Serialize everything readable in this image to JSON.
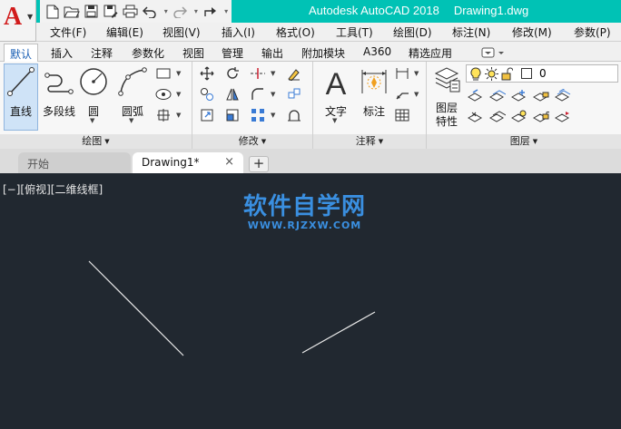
{
  "app": {
    "title": "Autodesk AutoCAD 2018",
    "document": "Drawing1.dwg",
    "logo": "A",
    "accent": "#00c2b5"
  },
  "quick_access": [
    "new-icon",
    "open-icon",
    "save-icon",
    "saveas-icon",
    "print-icon",
    "undo-icon",
    "redo-icon",
    "share-icon"
  ],
  "menu": [
    "文件(F)",
    "编辑(E)",
    "视图(V)",
    "插入(I)",
    "格式(O)",
    "工具(T)",
    "绘图(D)",
    "标注(N)",
    "修改(M)",
    "参数(P)"
  ],
  "ribbon_tabs": [
    "默认",
    "插入",
    "注释",
    "参数化",
    "视图",
    "管理",
    "输出",
    "附加模块",
    "A360",
    "精选应用"
  ],
  "active_ribbon_tab": "默认",
  "panels": {
    "draw": {
      "title": "绘图",
      "line": "直线",
      "polyline": "多段线",
      "circle": "圆",
      "arc": "圆弧"
    },
    "modify": {
      "title": "修改"
    },
    "annotation": {
      "title": "注释",
      "text": "文字",
      "dimension": "标注"
    },
    "layers": {
      "title": "图层",
      "properties_line1": "图层",
      "properties_line2": "特性",
      "current_layer": "0"
    }
  },
  "doc_tabs": {
    "start": "开始",
    "drawing": "Drawing1*",
    "close": "×",
    "add": "+"
  },
  "viewport": {
    "label": "[−][俯视][二维线框]",
    "background": "#212830"
  },
  "watermark": {
    "cn": "软件自学网",
    "url": "WWW.RJZXW.COM"
  }
}
